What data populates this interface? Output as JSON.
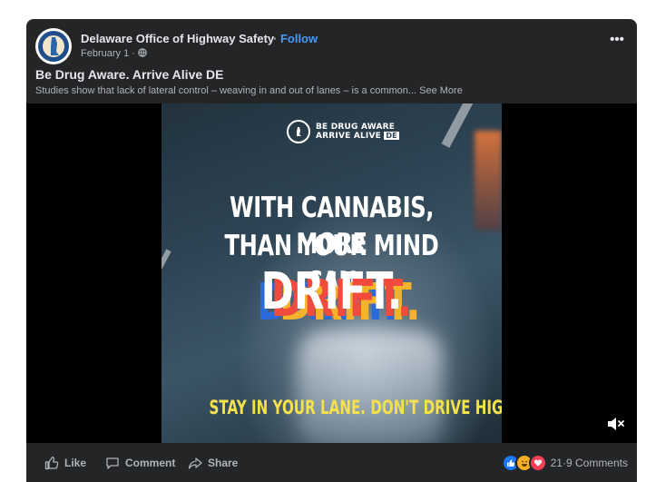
{
  "post": {
    "page_name": "Delaware Office of Highway Safety",
    "separator": " · ",
    "follow_label": "Follow",
    "date": "February 1",
    "meta_sep": " · ",
    "privacy_icon": "globe-icon",
    "more_icon": "more-options-icon",
    "more_glyph": "•••",
    "title": "Be Drug Aware. Arrive Alive DE",
    "body": "Studies show that lack of lateral control – weaving in and out of lanes – is a common...",
    "see_more": "See More"
  },
  "video": {
    "brand_line1": "BE DRUG AWARE",
    "brand_line2": "ARRIVE ALIVE",
    "brand_badge": "DE",
    "headline_line1": "WITH CANNABIS, MORE",
    "headline_line2": "THAN YOUR MIND CAN",
    "drift_word": "DRIFT.",
    "tagline": "STAY IN YOUR LANE. DON'T DRIVE HIGH.",
    "mute_icon": "muted-speaker-icon"
  },
  "actions": {
    "like": "Like",
    "comment": "Comment",
    "share": "Share"
  },
  "reactions": {
    "icons": [
      "like-reaction-icon",
      "haha-reaction-icon",
      "love-reaction-icon"
    ],
    "count": "21",
    "separator": " · ",
    "comments": "9 Comments"
  },
  "colors": {
    "card_bg": "#242526",
    "link_blue": "#4599ff",
    "tagline_yellow": "#f5e14b",
    "like_blue": "#1877f2",
    "love_red": "#f33e58",
    "haha_yellow": "#f7b125"
  }
}
